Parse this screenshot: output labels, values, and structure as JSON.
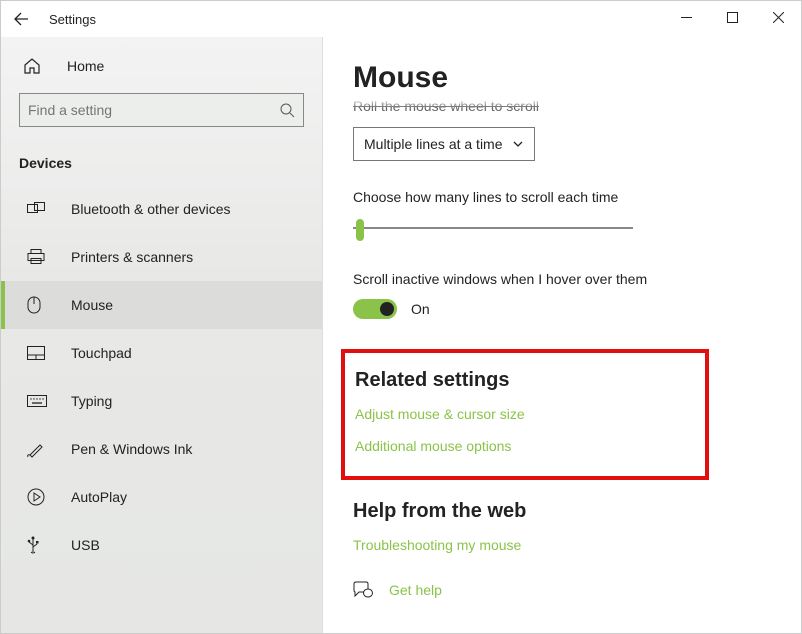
{
  "window": {
    "title": "Settings"
  },
  "sidebar": {
    "home_label": "Home",
    "search_placeholder": "Find a setting",
    "section_header": "Devices",
    "items": [
      {
        "label": "Bluetooth & other devices",
        "icon": "bluetooth-devices-icon"
      },
      {
        "label": "Printers & scanners",
        "icon": "printer-icon"
      },
      {
        "label": "Mouse",
        "icon": "mouse-icon",
        "selected": true
      },
      {
        "label": "Touchpad",
        "icon": "touchpad-icon"
      },
      {
        "label": "Typing",
        "icon": "keyboard-icon"
      },
      {
        "label": "Pen & Windows Ink",
        "icon": "pen-icon"
      },
      {
        "label": "AutoPlay",
        "icon": "autoplay-icon"
      },
      {
        "label": "USB",
        "icon": "usb-icon"
      }
    ]
  },
  "main": {
    "page_title": "Mouse",
    "cutoff_setting_label": "Roll the mouse wheel to scroll",
    "dropdown_value": "Multiple lines at a time",
    "lines_label": "Choose how many lines to scroll each time",
    "hover_label": "Scroll inactive windows when I hover over them",
    "toggle_state": "On",
    "related_heading": "Related settings",
    "link_adjust": "Adjust mouse & cursor size",
    "link_additional": "Additional mouse options",
    "help_heading": "Help from the web",
    "link_troubleshoot": "Troubleshooting my mouse",
    "get_help_label": "Get help"
  },
  "colors": {
    "accent": "#8bc34a",
    "highlight_box": "#e20f0f"
  }
}
